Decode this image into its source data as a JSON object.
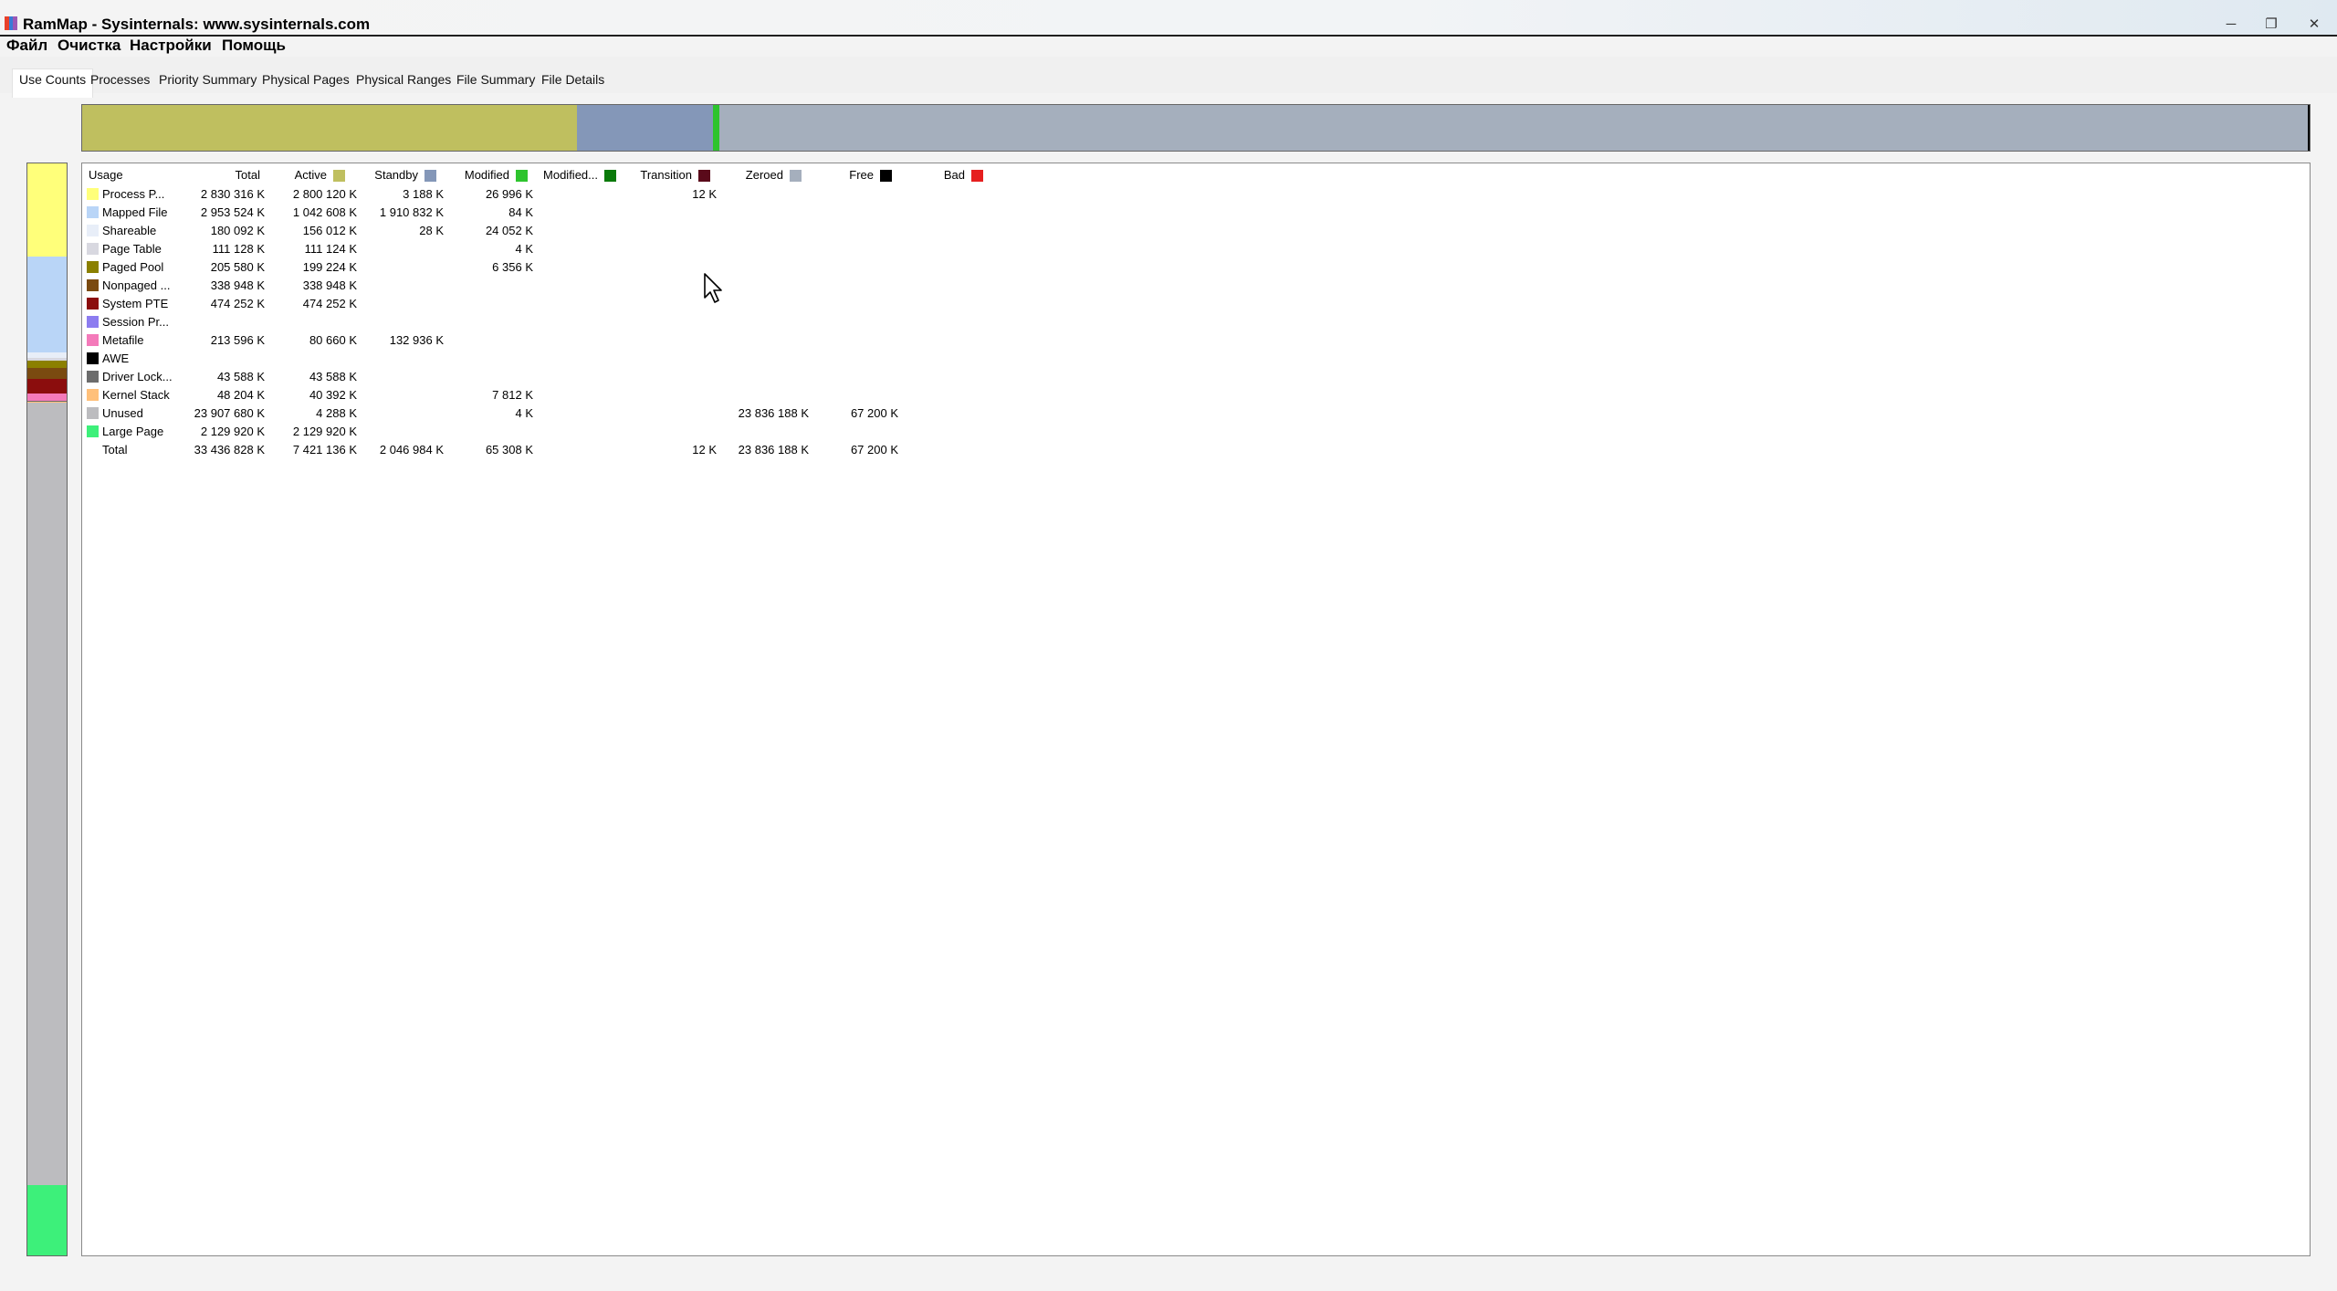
{
  "window": {
    "title": "RamMap - Sysinternals: www.sysinternals.com",
    "icon": "rammap-app-icon",
    "controls": {
      "minimize": "─",
      "restore": "❐",
      "close": "✕"
    }
  },
  "menu": [
    "Файл",
    "Очистка",
    "Настройки",
    "Помощь"
  ],
  "tabs": [
    "Use Counts",
    "Processes",
    "Priority Summary",
    "Physical Pages",
    "Physical Ranges",
    "File Summary",
    "File Details"
  ],
  "active_tab": "Use Counts",
  "colors": {
    "active": "#bfbf5f",
    "standby": "#8497b8",
    "modified": "#2ec42e",
    "modified_no_write": "#0a7a0a",
    "transition": "#5a0a1a",
    "zeroed": "#a5afbd",
    "free": "#000000",
    "bad": "#e61f1f"
  },
  "overview_bar": [
    {
      "name": "Active",
      "fraction": 0.222,
      "color": "#bfbf5f"
    },
    {
      "name": "Standby",
      "fraction": 0.061,
      "color": "#8497b8"
    },
    {
      "name": "Modified",
      "fraction": 0.003,
      "color": "#2ec42e"
    },
    {
      "name": "Zeroed",
      "fraction": 0.713,
      "color": "#a5afbd"
    },
    {
      "name": "Free",
      "fraction": 0.002,
      "color": "#000000"
    }
  ],
  "usage_bar": [
    {
      "name": "Process Private",
      "fraction": 0.085,
      "color": "#ffff7a"
    },
    {
      "name": "Mapped File",
      "fraction": 0.088,
      "color": "#b9d5f7"
    },
    {
      "name": "Shareable",
      "fraction": 0.005,
      "color": "#e8eef8"
    },
    {
      "name": "Page Table",
      "fraction": 0.003,
      "color": "#d8d8e0"
    },
    {
      "name": "Paged Pool",
      "fraction": 0.006,
      "color": "#8b8000"
    },
    {
      "name": "Nonpaged Pool",
      "fraction": 0.01,
      "color": "#7a4a10"
    },
    {
      "name": "System PTE",
      "fraction": 0.014,
      "color": "#8b0d0d"
    },
    {
      "name": "Metafile",
      "fraction": 0.006,
      "color": "#f47aba"
    },
    {
      "name": "Driver Locked",
      "fraction": 0.001,
      "color": "#6c6c6c"
    },
    {
      "name": "Kernel Stack",
      "fraction": 0.001,
      "color": "#ffc07a"
    },
    {
      "name": "Unused",
      "fraction": 0.717,
      "color": "#bcbcbf"
    },
    {
      "name": "Large Page",
      "fraction": 0.064,
      "color": "#3df07a"
    }
  ],
  "table": {
    "columns": [
      {
        "label": "Usage",
        "swatch": null
      },
      {
        "label": "Total",
        "swatch": null
      },
      {
        "label": "Active",
        "swatch": "#bfbf5f"
      },
      {
        "label": "Standby",
        "swatch": "#8497b8"
      },
      {
        "label": "Modified",
        "swatch": "#2ec42e"
      },
      {
        "label": "Modified...",
        "swatch": "#0a7a0a"
      },
      {
        "label": "Transition",
        "swatch": "#5a0a1a"
      },
      {
        "label": "Zeroed",
        "swatch": "#a5afbd"
      },
      {
        "label": "Free",
        "swatch": "#000000"
      },
      {
        "label": "Bad",
        "swatch": "#e61f1f"
      }
    ],
    "rows": [
      {
        "name": "Process P...",
        "color": "#ffff7a",
        "values": [
          "2 830 316 K",
          "2 800 120 K",
          "3 188 K",
          "26 996 K",
          "",
          "12 K",
          "",
          "",
          ""
        ]
      },
      {
        "name": "Mapped File",
        "color": "#b9d5f7",
        "values": [
          "2 953 524 K",
          "1 042 608 K",
          "1 910 832 K",
          "84 K",
          "",
          "",
          "",
          "",
          ""
        ]
      },
      {
        "name": "Shareable",
        "color": "#e8eef8",
        "values": [
          "180 092 K",
          "156 012 K",
          "28 K",
          "24 052 K",
          "",
          "",
          "",
          "",
          ""
        ]
      },
      {
        "name": "Page Table",
        "color": "#d8d8e0",
        "values": [
          "111 128 K",
          "111 124 K",
          "",
          "4 K",
          "",
          "",
          "",
          "",
          ""
        ]
      },
      {
        "name": "Paged Pool",
        "color": "#8b8000",
        "values": [
          "205 580 K",
          "199 224 K",
          "",
          "6 356 K",
          "",
          "",
          "",
          "",
          ""
        ]
      },
      {
        "name": "Nonpaged ...",
        "color": "#7a4a10",
        "values": [
          "338 948 K",
          "338 948 K",
          "",
          "",
          "",
          "",
          "",
          "",
          ""
        ]
      },
      {
        "name": "System PTE",
        "color": "#8b0d0d",
        "values": [
          "474 252 K",
          "474 252 K",
          "",
          "",
          "",
          "",
          "",
          "",
          ""
        ]
      },
      {
        "name": "Session Pr...",
        "color": "#8c7cf0",
        "values": [
          "",
          "",
          "",
          "",
          "",
          "",
          "",
          "",
          ""
        ]
      },
      {
        "name": "Metafile",
        "color": "#f47aba",
        "values": [
          "213 596 K",
          "80 660 K",
          "132 936 K",
          "",
          "",
          "",
          "",
          "",
          ""
        ]
      },
      {
        "name": "AWE",
        "color": "#000000",
        "values": [
          "",
          "",
          "",
          "",
          "",
          "",
          "",
          "",
          ""
        ]
      },
      {
        "name": "Driver Lock...",
        "color": "#6c6c6c",
        "values": [
          "43 588 K",
          "43 588 K",
          "",
          "",
          "",
          "",
          "",
          "",
          ""
        ]
      },
      {
        "name": "Kernel Stack",
        "color": "#ffc07a",
        "values": [
          "48 204 K",
          "40 392 K",
          "",
          "7 812 K",
          "",
          "",
          "",
          "",
          ""
        ]
      },
      {
        "name": "Unused",
        "color": "#bcbcbf",
        "values": [
          "23 907 680 K",
          "4 288 K",
          "",
          "4 K",
          "",
          "",
          "23 836 188 K",
          "67 200 K",
          ""
        ]
      },
      {
        "name": "Large Page",
        "color": "#3df07a",
        "values": [
          "2 129 920 K",
          "2 129 920 K",
          "",
          "",
          "",
          "",
          "",
          "",
          ""
        ]
      },
      {
        "name": "Total",
        "color": null,
        "values": [
          "33 436 828 K",
          "7 421 136 K",
          "2 046 984 K",
          "65 308 K",
          "",
          "12 K",
          "23 836 188 K",
          "67 200 K",
          ""
        ]
      }
    ]
  }
}
